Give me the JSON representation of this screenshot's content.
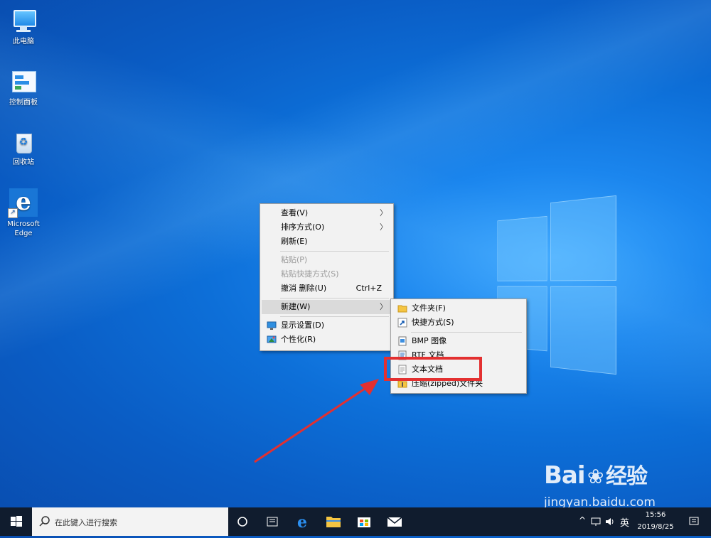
{
  "desktop": {
    "icons": [
      {
        "label": "此电脑",
        "icon": "this-pc-icon"
      },
      {
        "label": "控制面板",
        "icon": "control-panel-icon"
      },
      {
        "label": "回收站",
        "icon": "recycle-bin-icon"
      },
      {
        "label_line1": "Microsoft",
        "label_line2": "Edge",
        "icon": "edge-icon"
      }
    ]
  },
  "context_menu": {
    "items": [
      {
        "label": "查看(V)",
        "submenu": true
      },
      {
        "label": "排序方式(O)",
        "submenu": true
      },
      {
        "label": "刷新(E)"
      },
      {
        "label": "粘贴(P)",
        "disabled": true
      },
      {
        "label": "粘贴快捷方式(S)",
        "disabled": true
      },
      {
        "label": "撤消 删除(U)",
        "shortcut": "Ctrl+Z"
      },
      {
        "label": "新建(W)",
        "submenu": true,
        "highlighted": true
      },
      {
        "label": "显示设置(D)",
        "icon": "display-settings-icon"
      },
      {
        "label": "个性化(R)",
        "icon": "personalize-icon"
      }
    ]
  },
  "new_submenu": {
    "items": [
      {
        "label": "文件夹(F)",
        "icon": "folder-icon"
      },
      {
        "label": "快捷方式(S)",
        "icon": "shortcut-icon"
      },
      {
        "label": "BMP 图像",
        "icon": "bmp-image-icon"
      },
      {
        "label": "RTF 文档",
        "icon": "rtf-document-icon"
      },
      {
        "label": "文本文档",
        "icon": "text-document-icon",
        "highlighted_by_annotation": true
      },
      {
        "label": "压缩(zipped)文件夹",
        "icon": "zip-folder-icon"
      }
    ]
  },
  "taskbar": {
    "search_placeholder": "在此键入进行搜索",
    "ime": "英",
    "time": "15:56",
    "date": "2019/8/25"
  },
  "watermark": {
    "brand_left": "Bai",
    "brand_right": "经验",
    "url": "jingyan.baidu.com"
  },
  "colors": {
    "annotation_red": "#e33030",
    "taskbar": "#101c2e",
    "desktop_blue": "#0d6fd8"
  }
}
